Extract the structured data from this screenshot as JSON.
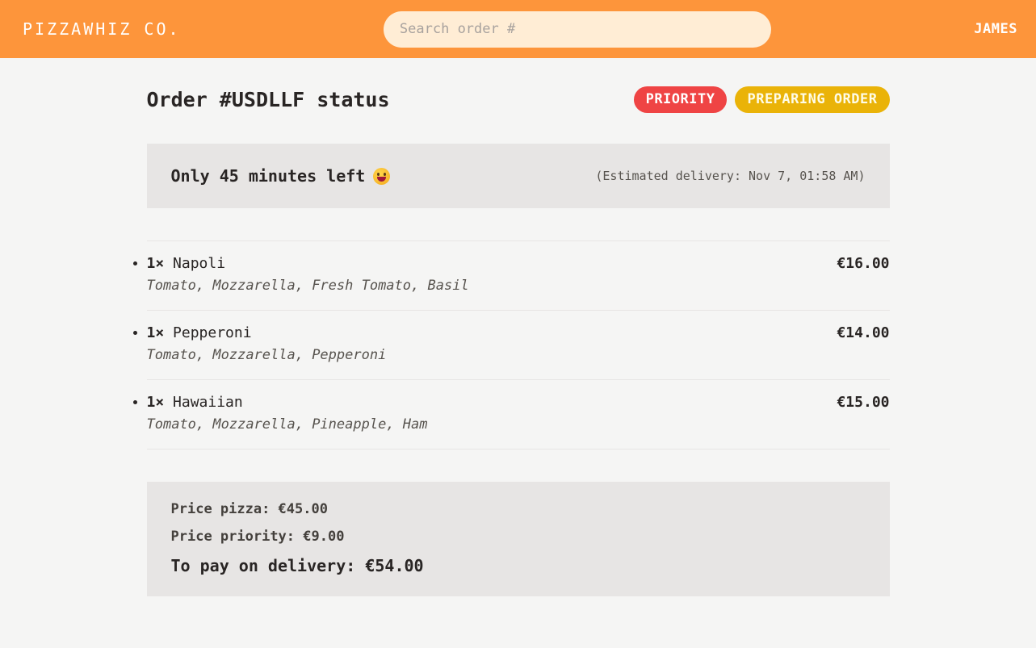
{
  "header": {
    "logo": "PIZZAWHIZ CO.",
    "search_placeholder": "Search order #",
    "search_value": "",
    "user": "JAMES"
  },
  "order": {
    "title": "Order #USDLLF status",
    "badges": {
      "priority": "PRIORITY",
      "status": "PREPARING ORDER"
    },
    "countdown": "Only 45 minutes left",
    "countdown_icon": "grinning-face-emoji",
    "eta": "(Estimated delivery: Nov 7, 01:58 AM)"
  },
  "items": [
    {
      "qty": "1×",
      "name": "Napoli",
      "price": "€16.00",
      "ingredients": "Tomato, Mozzarella, Fresh Tomato, Basil"
    },
    {
      "qty": "1×",
      "name": "Pepperoni",
      "price": "€14.00",
      "ingredients": "Tomato, Mozzarella, Pepperoni"
    },
    {
      "qty": "1×",
      "name": "Hawaiian",
      "price": "€15.00",
      "ingredients": "Tomato, Mozzarella, Pineapple, Ham"
    }
  ],
  "summary": {
    "price_pizza": "Price pizza: €45.00",
    "price_priority": "Price priority: €9.00",
    "total": "To pay on delivery: €54.00"
  },
  "colors": {
    "header": "#fd953b",
    "priority": "#ef4444",
    "status": "#eab308",
    "panel": "#e7e5e4",
    "background": "#f5f5f4"
  }
}
